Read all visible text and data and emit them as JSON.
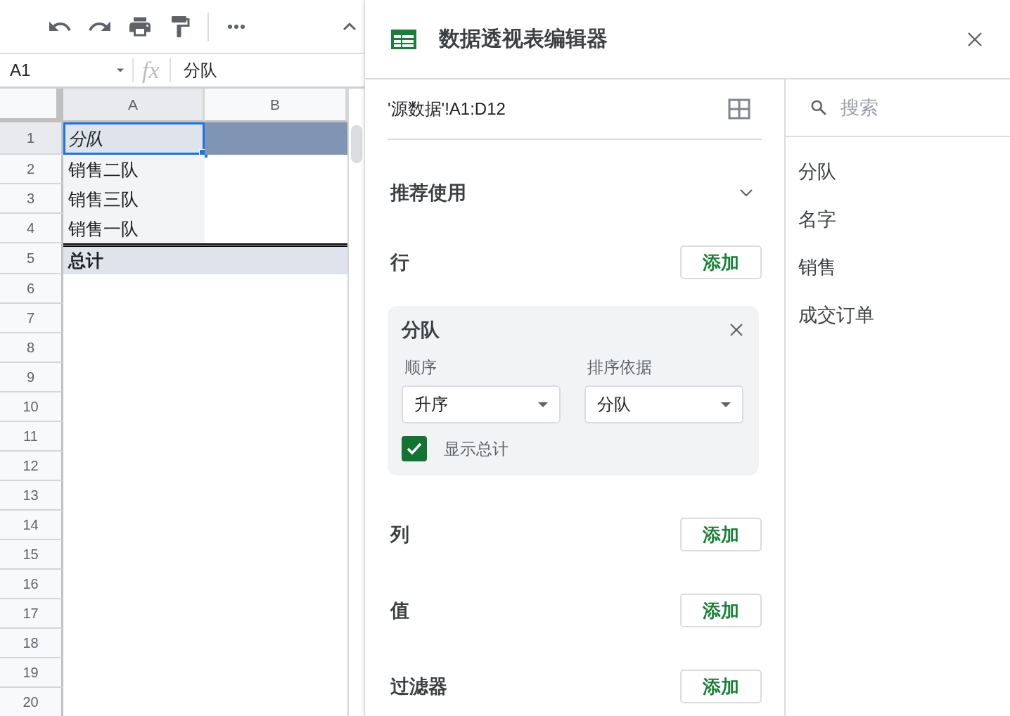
{
  "formula_bar": {
    "cell_ref": "A1",
    "fx": "fx",
    "value": "分队"
  },
  "sheet": {
    "columns": [
      "A",
      "B"
    ],
    "rows": [
      {
        "number": "1",
        "cell_a": "分队",
        "kind": "header",
        "selected": true
      },
      {
        "number": "2",
        "cell_a": "销售二队",
        "kind": "data",
        "selected": false
      },
      {
        "number": "3",
        "cell_a": "销售三队",
        "kind": "data",
        "selected": false
      },
      {
        "number": "4",
        "cell_a": "销售一队",
        "kind": "data",
        "selected": false
      },
      {
        "number": "5",
        "cell_a": "总计",
        "kind": "total",
        "selected": false
      },
      {
        "number": "6",
        "kind": "empty",
        "selected": false
      },
      {
        "number": "7",
        "kind": "empty",
        "selected": false
      },
      {
        "number": "8",
        "kind": "empty",
        "selected": false
      },
      {
        "number": "9",
        "kind": "empty",
        "selected": false
      },
      {
        "number": "10",
        "kind": "empty",
        "selected": false
      },
      {
        "number": "11",
        "kind": "empty",
        "selected": false
      },
      {
        "number": "12",
        "kind": "empty",
        "selected": false
      },
      {
        "number": "13",
        "kind": "empty",
        "selected": false
      },
      {
        "number": "14",
        "kind": "empty",
        "selected": false
      },
      {
        "number": "15",
        "kind": "empty",
        "selected": false
      },
      {
        "number": "16",
        "kind": "empty",
        "selected": false
      },
      {
        "number": "17",
        "kind": "empty",
        "selected": false
      },
      {
        "number": "18",
        "kind": "empty",
        "selected": false
      },
      {
        "number": "19",
        "kind": "empty",
        "selected": false
      },
      {
        "number": "20",
        "kind": "empty",
        "selected": false
      }
    ]
  },
  "editor": {
    "title": "数据透视表编辑器",
    "source_range": "'源数据'!A1:D12",
    "suggested": {
      "title": "推荐使用",
      "expanded": false
    },
    "sections": [
      {
        "title": "行",
        "button": "添加",
        "cards": [
          {
            "title": "分队",
            "order_label": "顺序",
            "order_value": "升序",
            "sort_label": "排序依据",
            "sort_value": "分队",
            "show_totals_label": "显示总计",
            "show_totals": true
          }
        ]
      },
      {
        "title": "列",
        "button": "添加"
      },
      {
        "title": "值",
        "button": "添加"
      },
      {
        "title": "过滤器",
        "button": "添加"
      }
    ]
  },
  "fields": {
    "placeholder": "搜索",
    "items": [
      "分队",
      "名字",
      "销售",
      "成交订单"
    ]
  }
}
